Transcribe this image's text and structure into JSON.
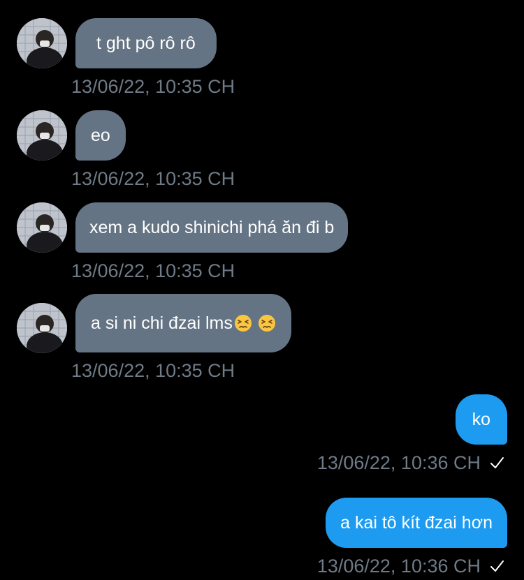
{
  "thread": {
    "incoming": [
      {
        "text": "t ght pô rô rô",
        "timestamp": "13/06/22, 10:35 CH"
      },
      {
        "text": "eo",
        "timestamp": "13/06/22, 10:35 CH"
      },
      {
        "text": "xem a kudo shinichi phá ăn đi b",
        "timestamp": "13/06/22, 10:35 CH"
      },
      {
        "text": "a si ni chi đzai lms",
        "emoji": [
          "persevering-face",
          "persevering-face"
        ],
        "timestamp": "13/06/22, 10:35 CH"
      }
    ],
    "outgoing": [
      {
        "text": "ko",
        "timestamp": "13/06/22, 10:36 CH",
        "status_icon": "checkmark-icon"
      },
      {
        "text": "a kai tô kít đzai hơn",
        "timestamp": "13/06/22, 10:36 CH",
        "status_icon": "checkmark-icon"
      }
    ]
  },
  "colors": {
    "background": "#000000",
    "incoming_bubble": "#657484",
    "outgoing_bubble": "#1d9bf0",
    "timestamp": "#6f7b87",
    "text": "#ffffff"
  }
}
